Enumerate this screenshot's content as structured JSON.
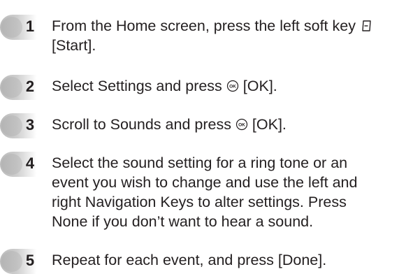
{
  "steps": [
    {
      "number": "1",
      "line1": "From the Home screen, press the left soft key",
      "icon": "left-soft-key-icon",
      "line2": "[Start]."
    },
    {
      "number": "2",
      "before": "Select Settings and press",
      "icon": "ok-key-icon",
      "after": "[OK]."
    },
    {
      "number": "3",
      "before": "Scroll to Sounds and press",
      "icon": "ok-key-icon",
      "after": "[OK]."
    },
    {
      "number": "4",
      "lines": [
        "Select the sound setting for a ring tone or an",
        "event you wish to change and use the left and",
        "right Navigation Keys to alter settings. Press",
        "None if you don’t want to hear a sound."
      ]
    },
    {
      "number": "5",
      "text": "Repeat for each event, and press [Done]."
    }
  ]
}
